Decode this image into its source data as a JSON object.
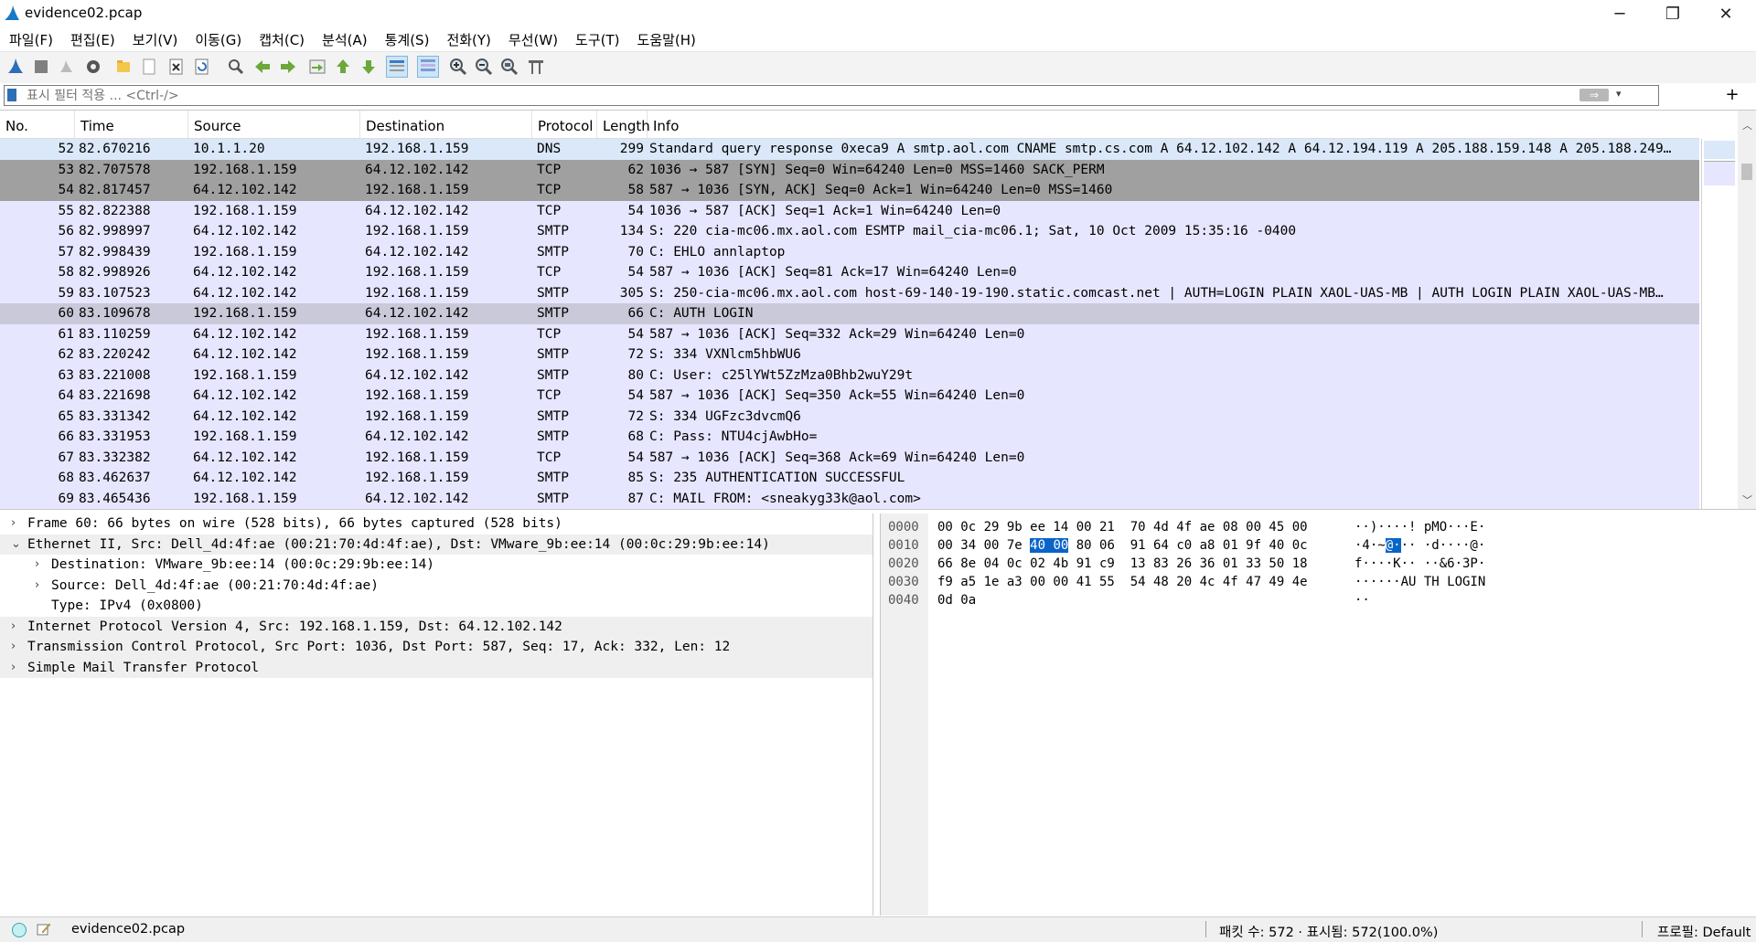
{
  "window": {
    "title": "evidence02.pcap",
    "minimize": "─",
    "maximize": "❐",
    "close": "✕"
  },
  "menu": [
    "파일(F)",
    "편집(E)",
    "보기(V)",
    "이동(G)",
    "캡처(C)",
    "분석(A)",
    "통계(S)",
    "전화(Y)",
    "무선(W)",
    "도구(T)",
    "도움말(H)"
  ],
  "toolbar": {
    "icons": [
      "start-capture-icon",
      "stop-capture-icon",
      "restart-capture-icon",
      "capture-options-icon",
      "open-file-icon",
      "save-file-icon",
      "close-file-icon",
      "reload-file-icon",
      "find-packet-icon",
      "go-back-icon",
      "go-forward-icon",
      "go-to-packet-icon",
      "first-packet-icon",
      "last-packet-icon",
      "autoscroll-icon",
      "colorize-icon",
      "zoom-in-icon",
      "zoom-out-icon",
      "normal-size-icon",
      "resize-columns-icon"
    ]
  },
  "filter": {
    "placeholder": "표시 필터 적용 ... <Ctrl-/>",
    "value": "",
    "apply": "⇒",
    "dropdown": "▾",
    "add": "+"
  },
  "packet_list": {
    "columns": {
      "no": "No.",
      "time": "Time",
      "source": "Source",
      "destination": "Destination",
      "protocol": "Protocol",
      "length": "Length",
      "info": "Info"
    },
    "rows": [
      {
        "no": "52",
        "time": "82.670216",
        "src": "10.1.1.20",
        "dst": "192.168.1.159",
        "proto": "DNS",
        "len": "299",
        "info": "Standard query response 0xeca9 A smtp.aol.com CNAME smtp.cs.com A 64.12.102.142 A 64.12.194.119 A 205.188.159.148 A 205.188.249…",
        "style": "dns"
      },
      {
        "no": "53",
        "time": "82.707578",
        "src": "192.168.1.159",
        "dst": "64.12.102.142",
        "proto": "TCP",
        "len": "62",
        "info": "1036 → 587 [SYN] Seq=0 Win=64240 Len=0 MSS=1460 SACK_PERM",
        "style": "syn"
      },
      {
        "no": "54",
        "time": "82.817457",
        "src": "64.12.102.142",
        "dst": "192.168.1.159",
        "proto": "TCP",
        "len": "58",
        "info": "587 → 1036 [SYN, ACK] Seq=0 Ack=1 Win=64240 Len=0 MSS=1460",
        "style": "syn"
      },
      {
        "no": "55",
        "time": "82.822388",
        "src": "192.168.1.159",
        "dst": "64.12.102.142",
        "proto": "TCP",
        "len": "54",
        "info": "1036 → 587 [ACK] Seq=1 Ack=1 Win=64240 Len=0",
        "style": "tcp"
      },
      {
        "no": "56",
        "time": "82.998997",
        "src": "64.12.102.142",
        "dst": "192.168.1.159",
        "proto": "SMTP",
        "len": "134",
        "info": "S: 220 cia-mc06.mx.aol.com ESMTP mail_cia-mc06.1; Sat, 10 Oct 2009 15:35:16 -0400",
        "style": "smtp"
      },
      {
        "no": "57",
        "time": "82.998439",
        "src": "192.168.1.159",
        "dst": "64.12.102.142",
        "proto": "SMTP",
        "len": "70",
        "info": "C: EHLO annlaptop",
        "style": "smtp"
      },
      {
        "no": "58",
        "time": "82.998926",
        "src": "64.12.102.142",
        "dst": "192.168.1.159",
        "proto": "TCP",
        "len": "54",
        "info": "587 → 1036 [ACK] Seq=81 Ack=17 Win=64240 Len=0",
        "style": "tcp"
      },
      {
        "no": "59",
        "time": "83.107523",
        "src": "64.12.102.142",
        "dst": "192.168.1.159",
        "proto": "SMTP",
        "len": "305",
        "info": "S: 250-cia-mc06.mx.aol.com host-69-140-19-190.static.comcast.net | AUTH=LOGIN PLAIN XAOL-UAS-MB  | AUTH LOGIN PLAIN XAOL-UAS-MB…",
        "style": "smtp"
      },
      {
        "no": "60",
        "time": "83.109678",
        "src": "192.168.1.159",
        "dst": "64.12.102.142",
        "proto": "SMTP",
        "len": "66",
        "info": "C: AUTH LOGIN",
        "style": "sel"
      },
      {
        "no": "61",
        "time": "83.110259",
        "src": "64.12.102.142",
        "dst": "192.168.1.159",
        "proto": "TCP",
        "len": "54",
        "info": "587 → 1036 [ACK] Seq=332 Ack=29 Win=64240 Len=0",
        "style": "tcp"
      },
      {
        "no": "62",
        "time": "83.220242",
        "src": "64.12.102.142",
        "dst": "192.168.1.159",
        "proto": "SMTP",
        "len": "72",
        "info": "S: 334 VXNlcm5hbWU6",
        "style": "smtp"
      },
      {
        "no": "63",
        "time": "83.221008",
        "src": "192.168.1.159",
        "dst": "64.12.102.142",
        "proto": "SMTP",
        "len": "80",
        "info": "C: User: c25lYWt5ZzMza0Bhb2wuY29t",
        "style": "smtp"
      },
      {
        "no": "64",
        "time": "83.221698",
        "src": "64.12.102.142",
        "dst": "192.168.1.159",
        "proto": "TCP",
        "len": "54",
        "info": "587 → 1036 [ACK] Seq=350 Ack=55 Win=64240 Len=0",
        "style": "tcp"
      },
      {
        "no": "65",
        "time": "83.331342",
        "src": "64.12.102.142",
        "dst": "192.168.1.159",
        "proto": "SMTP",
        "len": "72",
        "info": "S: 334 UGFzc3dvcmQ6",
        "style": "smtp"
      },
      {
        "no": "66",
        "time": "83.331953",
        "src": "192.168.1.159",
        "dst": "64.12.102.142",
        "proto": "SMTP",
        "len": "68",
        "info": "C: Pass: NTU4cjAwbHo=",
        "style": "smtp"
      },
      {
        "no": "67",
        "time": "83.332382",
        "src": "64.12.102.142",
        "dst": "192.168.1.159",
        "proto": "TCP",
        "len": "54",
        "info": "587 → 1036 [ACK] Seq=368 Ack=69 Win=64240 Len=0",
        "style": "tcp"
      },
      {
        "no": "68",
        "time": "83.462637",
        "src": "64.12.102.142",
        "dst": "192.168.1.159",
        "proto": "SMTP",
        "len": "85",
        "info": "S: 235 AUTHENTICATION SUCCESSFUL",
        "style": "smtp"
      },
      {
        "no": "69",
        "time": "83.465436",
        "src": "192.168.1.159",
        "dst": "64.12.102.142",
        "proto": "SMTP",
        "len": "87",
        "info": "C: MAIL FROM: <sneakyg33k@aol.com>",
        "style": "smtp"
      }
    ]
  },
  "details": [
    {
      "arrow": "›",
      "indent": 0,
      "text": "Frame 60: 66 bytes on wire (528 bits), 66 bytes captured (528 bits)",
      "alt": false
    },
    {
      "arrow": "⌄",
      "indent": 0,
      "text": "Ethernet II, Src: Dell_4d:4f:ae (00:21:70:4d:4f:ae), Dst: VMware_9b:ee:14 (00:0c:29:9b:ee:14)",
      "alt": true
    },
    {
      "arrow": "›",
      "indent": 1,
      "text": "Destination: VMware_9b:ee:14 (00:0c:29:9b:ee:14)",
      "alt": false
    },
    {
      "arrow": "›",
      "indent": 1,
      "text": "Source: Dell_4d:4f:ae (00:21:70:4d:4f:ae)",
      "alt": false
    },
    {
      "arrow": "",
      "indent": 1,
      "text": "Type: IPv4 (0x0800)",
      "alt": false
    },
    {
      "arrow": "›",
      "indent": 0,
      "text": "Internet Protocol Version 4, Src: 192.168.1.159, Dst: 64.12.102.142",
      "alt": true
    },
    {
      "arrow": "›",
      "indent": 0,
      "text": "Transmission Control Protocol, Src Port: 1036, Dst Port: 587, Seq: 17, Ack: 332, Len: 12",
      "alt": true
    },
    {
      "arrow": "›",
      "indent": 0,
      "text": "Simple Mail Transfer Protocol",
      "alt": true
    }
  ],
  "bytes": [
    {
      "offset": "0000",
      "hex_pre": "00 0c 29 9b ee 14 00 21  70 4d 4f ae 08 00 45 00",
      "hex_hl": "",
      "hex_post": "",
      "ascii_pre": "··)····! pMO···E·",
      "ascii_hl": "",
      "ascii_post": ""
    },
    {
      "offset": "0010",
      "hex_pre": "00 34 00 7e ",
      "hex_hl": "40 00",
      "hex_post": " 80 06  91 64 c0 a8 01 9f 40 0c",
      "ascii_pre": "·4·~",
      "ascii_hl": "@·",
      "ascii_post": "·· ·d····@·"
    },
    {
      "offset": "0020",
      "hex_pre": "66 8e 04 0c 02 4b 91 c9  13 83 26 36 01 33 50 18",
      "hex_hl": "",
      "hex_post": "",
      "ascii_pre": "f····K·· ··&6·3P·",
      "ascii_hl": "",
      "ascii_post": ""
    },
    {
      "offset": "0030",
      "hex_pre": "f9 a5 1e a3 00 00 41 55  54 48 20 4c 4f 47 49 4e",
      "hex_hl": "",
      "hex_post": "",
      "ascii_pre": "······AU TH LOGIN",
      "ascii_hl": "",
      "ascii_post": ""
    },
    {
      "offset": "0040",
      "hex_pre": "0d 0a",
      "hex_hl": "",
      "hex_post": "",
      "ascii_pre": "··",
      "ascii_hl": "",
      "ascii_post": ""
    }
  ],
  "status": {
    "file": "evidence02.pcap",
    "packets": "패킷 수: 572 · 표시됨: 572(100.0%)",
    "profile": "프로필: Default"
  },
  "colors": {
    "dns_row": "#dae8f9",
    "smtp_row": "#e7e6ff",
    "syn_row": "#a0a0a0",
    "selected_row": "#c9c9d9",
    "byte_highlight": "#0a64c8"
  }
}
